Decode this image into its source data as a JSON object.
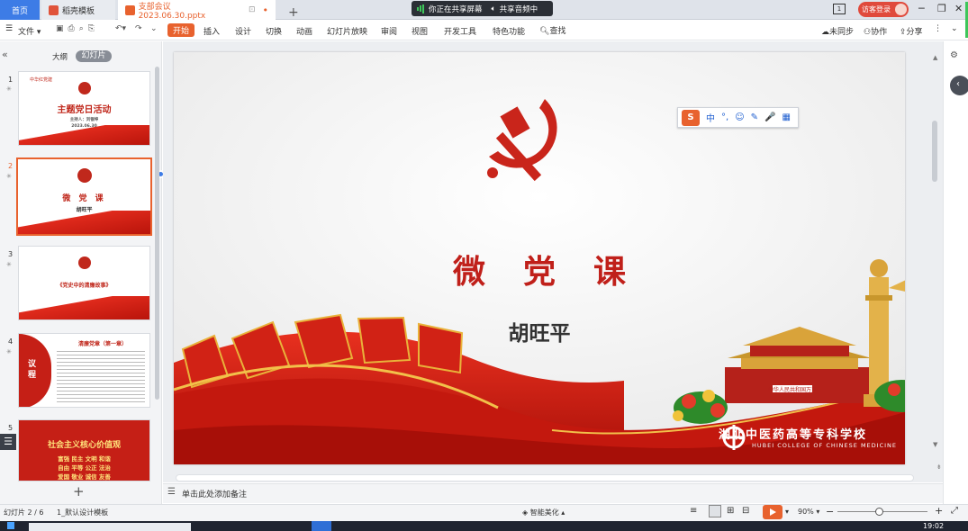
{
  "tabs": {
    "home": "首页",
    "template": "稻壳模板",
    "document": "支部会议2023.06.30.pptx",
    "add": "+"
  },
  "share": {
    "screen": "你正在共享屏幕",
    "audio": "共享音频中"
  },
  "window": {
    "page_count": "1",
    "visitor_login": "访客登录",
    "minimize": "─",
    "restore": "❐",
    "close": "✕"
  },
  "toolbar": {
    "file": "文件",
    "start": "开始",
    "insert": "插入",
    "design": "设计",
    "transition": "切换",
    "animation": "动画",
    "slideshow": "幻灯片放映",
    "review": "审阅",
    "view": "视图",
    "developer": "开发工具",
    "special": "特色功能",
    "search": "查找",
    "sync": "未同步",
    "collab": "协作",
    "share": "分享"
  },
  "panel": {
    "outline": "大纲",
    "slides": "幻灯片",
    "add": "+"
  },
  "thumbnails": [
    {
      "num": "1",
      "title": "主题党日活动",
      "top_left": "中华红党建",
      "host": "主持人：刘银坤",
      "date": "2023.06.30"
    },
    {
      "num": "2",
      "title": "微 党 课",
      "author": "胡旺平"
    },
    {
      "num": "3",
      "title": "《党史中的清廉故事》"
    },
    {
      "num": "4",
      "side": "议程",
      "title": "清廉党章（第一章）"
    },
    {
      "num": "5",
      "title": "社会主义核心价值观",
      "rows": [
        "富强 民主 文明 和谐",
        "自由 平等 公正 法治",
        "爱国 敬业 诚信 友善"
      ]
    }
  ],
  "slide": {
    "title": "微党课",
    "author": "胡旺平",
    "school_cn": "湖北中医药高等专科学校",
    "school_en": "HUBEI COLLEGE OF CHINESE MEDICINE",
    "gate_sign": "中华人民共和国万岁"
  },
  "ime": {
    "logo": "S",
    "mode": "中",
    "items": [
      "°,",
      "☺",
      "✎",
      "🎤",
      "▦"
    ]
  },
  "notes": {
    "placeholder": "单击此处添加备注"
  },
  "status": {
    "slide_info": "幻灯片 2 / 6",
    "template": "1_默认设计模板",
    "beautify": "智能美化",
    "zoom": "90%",
    "zoom_minus": "−",
    "zoom_plus": "+",
    "time": "19:02"
  },
  "colors": {
    "accent": "#e8622e",
    "party_red": "#c0201a",
    "share_bg": "#2b2f36"
  }
}
